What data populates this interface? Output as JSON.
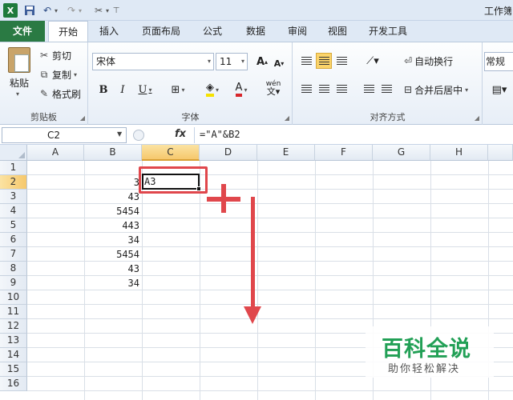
{
  "titlebar": {
    "title": "工作簿",
    "icons": {
      "app": "excel-logo-icon",
      "save": "save-icon",
      "undo": "undo-icon",
      "redo": "redo-icon",
      "tools": "tools-icon",
      "customize": "customize-quick-access-icon"
    }
  },
  "tabs": [
    {
      "label": "文件"
    },
    {
      "label": "开始"
    },
    {
      "label": "插入"
    },
    {
      "label": "页面布局"
    },
    {
      "label": "公式"
    },
    {
      "label": "数据"
    },
    {
      "label": "审阅"
    },
    {
      "label": "视图"
    },
    {
      "label": "开发工具"
    }
  ],
  "ribbon": {
    "clipboard": {
      "label": "剪贴板",
      "paste": "粘贴",
      "cut": "剪切",
      "copy": "复制",
      "format_painter": "格式刷"
    },
    "font": {
      "label": "字体",
      "font_name": "宋体",
      "font_size": "11",
      "bold": "B",
      "italic": "I",
      "underline": "U",
      "grow": "A",
      "shrink": "A",
      "font_color": "A",
      "phonetic": "wén"
    },
    "alignment": {
      "label": "对齐方式",
      "wrap_text": "自动换行",
      "merge_center": "合并后居中"
    },
    "number": {
      "format": "常规"
    },
    "colors": {
      "file_tab": "#2a7a43",
      "selected_header": "#f6c86c",
      "annotation": "#e0474c",
      "watermark": "#22a056"
    }
  },
  "formula_bar": {
    "name_box": "C2",
    "fx": "fx",
    "formula": "=\"A\"&B2"
  },
  "sheet": {
    "columns": [
      "A",
      "B",
      "C",
      "D",
      "E",
      "F",
      "G",
      "H"
    ],
    "rows": [
      "1",
      "2",
      "3",
      "4",
      "5",
      "6",
      "7",
      "8",
      "9",
      "10",
      "11",
      "12",
      "13",
      "14",
      "15",
      "16"
    ],
    "b_values": [
      "3",
      "43",
      "5454",
      "443",
      "34",
      "5454",
      "43",
      "34"
    ],
    "active_cell": "C2",
    "active_value": "A3"
  },
  "watermark": {
    "main": "百科全说",
    "sub": "助你轻松解决"
  }
}
